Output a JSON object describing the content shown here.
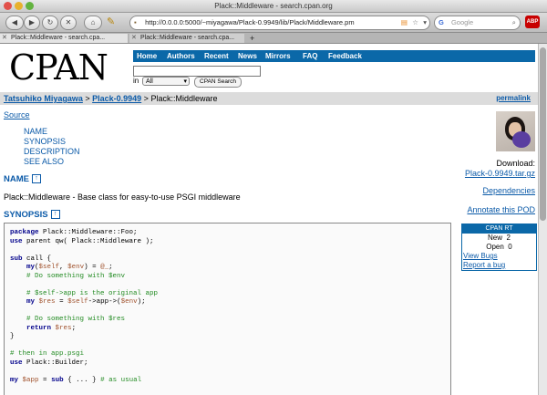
{
  "window": {
    "title": "Plack::Middleware - search.cpan.org"
  },
  "toolbar": {
    "url": "http://0.0.0.0:5000/~miyagawa/Plack-0.9949/lib/Plack/Middleware.pm",
    "search_placeholder": "Google",
    "abp_label": "ABP"
  },
  "tabs": [
    {
      "label": "Plack::Middleware - search.cpa..."
    },
    {
      "label": "Plack::Middleware - search.cpa..."
    },
    {
      "label": "+"
    }
  ],
  "cpan": {
    "logo": "CPAN",
    "nav": [
      "Home",
      "Authors",
      "Recent",
      "News",
      "Mirrors",
      "FAQ",
      "Feedback"
    ],
    "in_label": "in",
    "select_value": "All",
    "search_button": "CPAN Search"
  },
  "breadcrumb": {
    "author": "Tatsuhiko Miyagawa",
    "sep1": " > ",
    "dist": "Plack-0.9949",
    "sep2": " > ",
    "module": "Plack::Middleware",
    "permalink": "permalink"
  },
  "content": {
    "source": "Source",
    "toc": [
      "NAME",
      "SYNOPSIS",
      "DESCRIPTION",
      "SEE ALSO"
    ],
    "name_heading": "NAME",
    "description": "Plack::Middleware - Base class for easy-to-use PSGI middleware",
    "synopsis_heading": "SYNOPSIS"
  },
  "sidebar": {
    "download_label": "Download:",
    "download_file": "Plack-0.9949.tar.gz",
    "dependencies": "Dependencies",
    "annotate": "Annotate this POD",
    "rt": {
      "header": "CPAN RT",
      "new_label": "New",
      "new_count": "2",
      "open_label": "Open",
      "open_count": "0",
      "view_bugs": "View Bugs",
      "report_bug": "Report a bug"
    }
  },
  "code_lines": [
    {
      "t": "package Plack::Middleware::Foo;"
    },
    {
      "t": "use parent qw( Plack::Middleware );"
    },
    {
      "t": ""
    },
    {
      "t": "sub call {"
    },
    {
      "t": "    my($self, $env) = @_;"
    },
    {
      "t": "    # Do something with $env"
    },
    {
      "t": ""
    },
    {
      "t": "    # $self->app is the original app"
    },
    {
      "t": "    my $res = $self->app->($env);"
    },
    {
      "t": ""
    },
    {
      "t": "    # Do something with $res"
    },
    {
      "t": "    return $res;"
    },
    {
      "t": "}"
    },
    {
      "t": ""
    },
    {
      "t": "# then in app.psgi"
    },
    {
      "t": "use Plack::Builder;"
    },
    {
      "t": ""
    },
    {
      "t": "my $app = sub { ... } # as usual"
    }
  ]
}
